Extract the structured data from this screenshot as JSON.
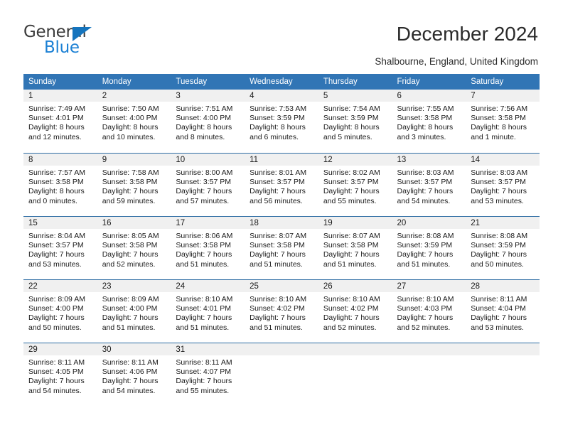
{
  "brand": {
    "word_one": "General",
    "word_two": "Blue",
    "triangle_color": "#1574bd",
    "word_two_color": "#1b80d4"
  },
  "header": {
    "title": "December 2024",
    "subtitle": "Shalbourne, England, United Kingdom",
    "accent_color": "#3175b5",
    "daynum_band_color": "#f0f0f0"
  },
  "weekday_headers": [
    "Sunday",
    "Monday",
    "Tuesday",
    "Wednesday",
    "Thursday",
    "Friday",
    "Saturday"
  ],
  "weeks": [
    [
      {
        "day": "1",
        "sunrise": "Sunrise: 7:49 AM",
        "sunset": "Sunset: 4:01 PM",
        "daylight_1": "Daylight: 8 hours",
        "daylight_2": "and 12 minutes."
      },
      {
        "day": "2",
        "sunrise": "Sunrise: 7:50 AM",
        "sunset": "Sunset: 4:00 PM",
        "daylight_1": "Daylight: 8 hours",
        "daylight_2": "and 10 minutes."
      },
      {
        "day": "3",
        "sunrise": "Sunrise: 7:51 AM",
        "sunset": "Sunset: 4:00 PM",
        "daylight_1": "Daylight: 8 hours",
        "daylight_2": "and 8 minutes."
      },
      {
        "day": "4",
        "sunrise": "Sunrise: 7:53 AM",
        "sunset": "Sunset: 3:59 PM",
        "daylight_1": "Daylight: 8 hours",
        "daylight_2": "and 6 minutes."
      },
      {
        "day": "5",
        "sunrise": "Sunrise: 7:54 AM",
        "sunset": "Sunset: 3:59 PM",
        "daylight_1": "Daylight: 8 hours",
        "daylight_2": "and 5 minutes."
      },
      {
        "day": "6",
        "sunrise": "Sunrise: 7:55 AM",
        "sunset": "Sunset: 3:58 PM",
        "daylight_1": "Daylight: 8 hours",
        "daylight_2": "and 3 minutes."
      },
      {
        "day": "7",
        "sunrise": "Sunrise: 7:56 AM",
        "sunset": "Sunset: 3:58 PM",
        "daylight_1": "Daylight: 8 hours",
        "daylight_2": "and 1 minute."
      }
    ],
    [
      {
        "day": "8",
        "sunrise": "Sunrise: 7:57 AM",
        "sunset": "Sunset: 3:58 PM",
        "daylight_1": "Daylight: 8 hours",
        "daylight_2": "and 0 minutes."
      },
      {
        "day": "9",
        "sunrise": "Sunrise: 7:58 AM",
        "sunset": "Sunset: 3:58 PM",
        "daylight_1": "Daylight: 7 hours",
        "daylight_2": "and 59 minutes."
      },
      {
        "day": "10",
        "sunrise": "Sunrise: 8:00 AM",
        "sunset": "Sunset: 3:57 PM",
        "daylight_1": "Daylight: 7 hours",
        "daylight_2": "and 57 minutes."
      },
      {
        "day": "11",
        "sunrise": "Sunrise: 8:01 AM",
        "sunset": "Sunset: 3:57 PM",
        "daylight_1": "Daylight: 7 hours",
        "daylight_2": "and 56 minutes."
      },
      {
        "day": "12",
        "sunrise": "Sunrise: 8:02 AM",
        "sunset": "Sunset: 3:57 PM",
        "daylight_1": "Daylight: 7 hours",
        "daylight_2": "and 55 minutes."
      },
      {
        "day": "13",
        "sunrise": "Sunrise: 8:03 AM",
        "sunset": "Sunset: 3:57 PM",
        "daylight_1": "Daylight: 7 hours",
        "daylight_2": "and 54 minutes."
      },
      {
        "day": "14",
        "sunrise": "Sunrise: 8:03 AM",
        "sunset": "Sunset: 3:57 PM",
        "daylight_1": "Daylight: 7 hours",
        "daylight_2": "and 53 minutes."
      }
    ],
    [
      {
        "day": "15",
        "sunrise": "Sunrise: 8:04 AM",
        "sunset": "Sunset: 3:57 PM",
        "daylight_1": "Daylight: 7 hours",
        "daylight_2": "and 53 minutes."
      },
      {
        "day": "16",
        "sunrise": "Sunrise: 8:05 AM",
        "sunset": "Sunset: 3:58 PM",
        "daylight_1": "Daylight: 7 hours",
        "daylight_2": "and 52 minutes."
      },
      {
        "day": "17",
        "sunrise": "Sunrise: 8:06 AM",
        "sunset": "Sunset: 3:58 PM",
        "daylight_1": "Daylight: 7 hours",
        "daylight_2": "and 51 minutes."
      },
      {
        "day": "18",
        "sunrise": "Sunrise: 8:07 AM",
        "sunset": "Sunset: 3:58 PM",
        "daylight_1": "Daylight: 7 hours",
        "daylight_2": "and 51 minutes."
      },
      {
        "day": "19",
        "sunrise": "Sunrise: 8:07 AM",
        "sunset": "Sunset: 3:58 PM",
        "daylight_1": "Daylight: 7 hours",
        "daylight_2": "and 51 minutes."
      },
      {
        "day": "20",
        "sunrise": "Sunrise: 8:08 AM",
        "sunset": "Sunset: 3:59 PM",
        "daylight_1": "Daylight: 7 hours",
        "daylight_2": "and 51 minutes."
      },
      {
        "day": "21",
        "sunrise": "Sunrise: 8:08 AM",
        "sunset": "Sunset: 3:59 PM",
        "daylight_1": "Daylight: 7 hours",
        "daylight_2": "and 50 minutes."
      }
    ],
    [
      {
        "day": "22",
        "sunrise": "Sunrise: 8:09 AM",
        "sunset": "Sunset: 4:00 PM",
        "daylight_1": "Daylight: 7 hours",
        "daylight_2": "and 50 minutes."
      },
      {
        "day": "23",
        "sunrise": "Sunrise: 8:09 AM",
        "sunset": "Sunset: 4:00 PM",
        "daylight_1": "Daylight: 7 hours",
        "daylight_2": "and 51 minutes."
      },
      {
        "day": "24",
        "sunrise": "Sunrise: 8:10 AM",
        "sunset": "Sunset: 4:01 PM",
        "daylight_1": "Daylight: 7 hours",
        "daylight_2": "and 51 minutes."
      },
      {
        "day": "25",
        "sunrise": "Sunrise: 8:10 AM",
        "sunset": "Sunset: 4:02 PM",
        "daylight_1": "Daylight: 7 hours",
        "daylight_2": "and 51 minutes."
      },
      {
        "day": "26",
        "sunrise": "Sunrise: 8:10 AM",
        "sunset": "Sunset: 4:02 PM",
        "daylight_1": "Daylight: 7 hours",
        "daylight_2": "and 52 minutes."
      },
      {
        "day": "27",
        "sunrise": "Sunrise: 8:10 AM",
        "sunset": "Sunset: 4:03 PM",
        "daylight_1": "Daylight: 7 hours",
        "daylight_2": "and 52 minutes."
      },
      {
        "day": "28",
        "sunrise": "Sunrise: 8:11 AM",
        "sunset": "Sunset: 4:04 PM",
        "daylight_1": "Daylight: 7 hours",
        "daylight_2": "and 53 minutes."
      }
    ],
    [
      {
        "day": "29",
        "sunrise": "Sunrise: 8:11 AM",
        "sunset": "Sunset: 4:05 PM",
        "daylight_1": "Daylight: 7 hours",
        "daylight_2": "and 54 minutes."
      },
      {
        "day": "30",
        "sunrise": "Sunrise: 8:11 AM",
        "sunset": "Sunset: 4:06 PM",
        "daylight_1": "Daylight: 7 hours",
        "daylight_2": "and 54 minutes."
      },
      {
        "day": "31",
        "sunrise": "Sunrise: 8:11 AM",
        "sunset": "Sunset: 4:07 PM",
        "daylight_1": "Daylight: 7 hours",
        "daylight_2": "and 55 minutes."
      },
      {
        "day": "",
        "sunrise": "",
        "sunset": "",
        "daylight_1": "",
        "daylight_2": ""
      },
      {
        "day": "",
        "sunrise": "",
        "sunset": "",
        "daylight_1": "",
        "daylight_2": ""
      },
      {
        "day": "",
        "sunrise": "",
        "sunset": "",
        "daylight_1": "",
        "daylight_2": ""
      },
      {
        "day": "",
        "sunrise": "",
        "sunset": "",
        "daylight_1": "",
        "daylight_2": ""
      }
    ]
  ]
}
